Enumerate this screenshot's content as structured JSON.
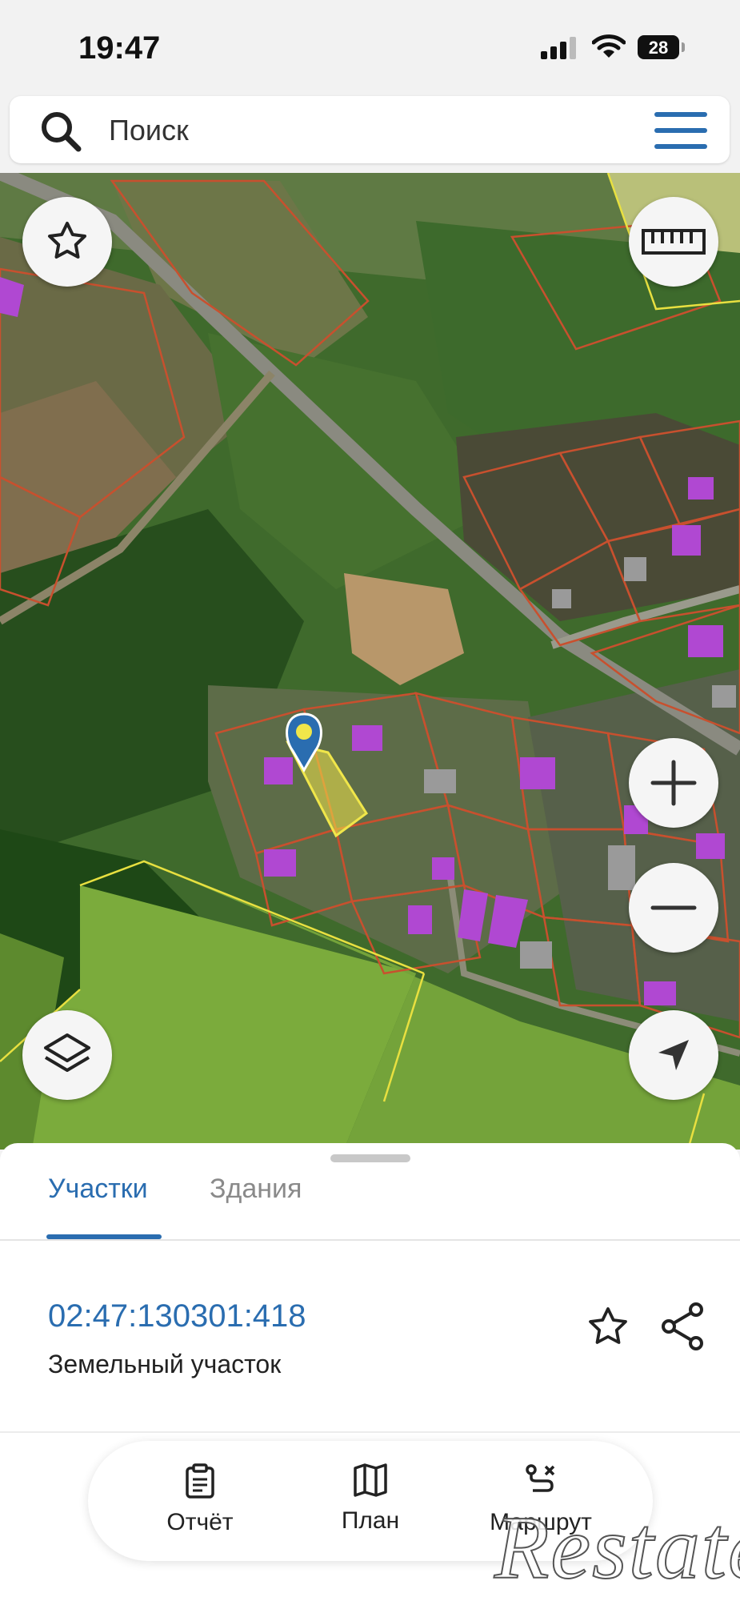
{
  "status_bar": {
    "time": "19:47",
    "battery": "28"
  },
  "search": {
    "placeholder": "Поиск"
  },
  "map": {
    "buttons": [
      "favorites",
      "ruler",
      "zoom-in",
      "zoom-out",
      "layers",
      "my-location"
    ]
  },
  "sheet": {
    "tabs": [
      {
        "label": "Участки",
        "active": true
      },
      {
        "label": "Здания",
        "active": false
      }
    ],
    "parcel": {
      "cadastral_number": "02:47:130301:418",
      "type": "Земельный участок"
    },
    "actions": [
      {
        "label": "Отчёт",
        "icon": "report-icon"
      },
      {
        "label": "План",
        "icon": "map-plan-icon"
      },
      {
        "label": "Маршрут",
        "icon": "route-icon"
      }
    ]
  },
  "watermark": "Restate",
  "colors": {
    "accent": "#2a6db0",
    "parcel_border": "#c8502e",
    "selected_parcel": "#f0e64a",
    "building": "#b04ad0"
  }
}
